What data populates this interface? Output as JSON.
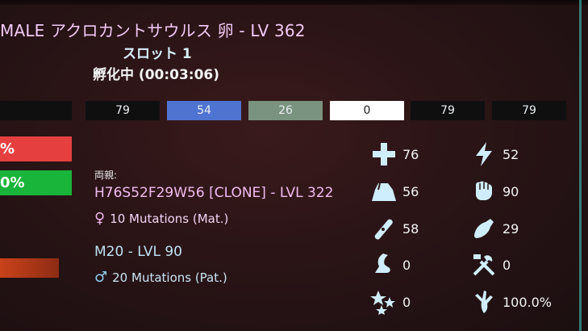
{
  "header": {
    "title": "MALE アクロカントサウルス 卵 - LV 362",
    "slot": "スロット 1",
    "hatching": "孵化中 (00:03:06)"
  },
  "color_regions": [
    {
      "value": "79",
      "color": "#0f0f10"
    },
    {
      "value": "54",
      "color": "#4f73d1"
    },
    {
      "value": "26",
      "color": "#7a9380"
    },
    {
      "value": "0",
      "color": "#ffffff"
    },
    {
      "value": "79",
      "color": "#0f0f10"
    },
    {
      "value": "79",
      "color": "#0f0f10"
    }
  ],
  "side_bars": {
    "red_label": "%",
    "green_label": "0%"
  },
  "parents": {
    "label": "両親:",
    "mother": {
      "name": "H76S52F29W56 [CLONE] - LVL 322",
      "mutations": "10 Mutations (Mat.)",
      "symbol": "♀"
    },
    "father": {
      "name": "M20 - LVL 90",
      "mutations": "20 Mutations (Pat.)",
      "symbol": "♂"
    }
  },
  "stats": [
    {
      "icon": "health-icon",
      "value": "76"
    },
    {
      "icon": "stamina-icon",
      "value": "52"
    },
    {
      "icon": "weight-icon",
      "value": "56"
    },
    {
      "icon": "melee-icon",
      "value": "90"
    },
    {
      "icon": "oxygen-icon",
      "value": "58"
    },
    {
      "icon": "food-icon",
      "value": "29"
    },
    {
      "icon": "speed-icon",
      "value": "0"
    },
    {
      "icon": "crafting-icon",
      "value": "0"
    },
    {
      "icon": "torpor-icon",
      "value": "0"
    },
    {
      "icon": "movement-icon",
      "value": "100.0%"
    }
  ],
  "colors": {
    "stat_icon": "#cfeefd",
    "male_color": "#8fd0f0",
    "female_color": "#f2b5f2"
  }
}
